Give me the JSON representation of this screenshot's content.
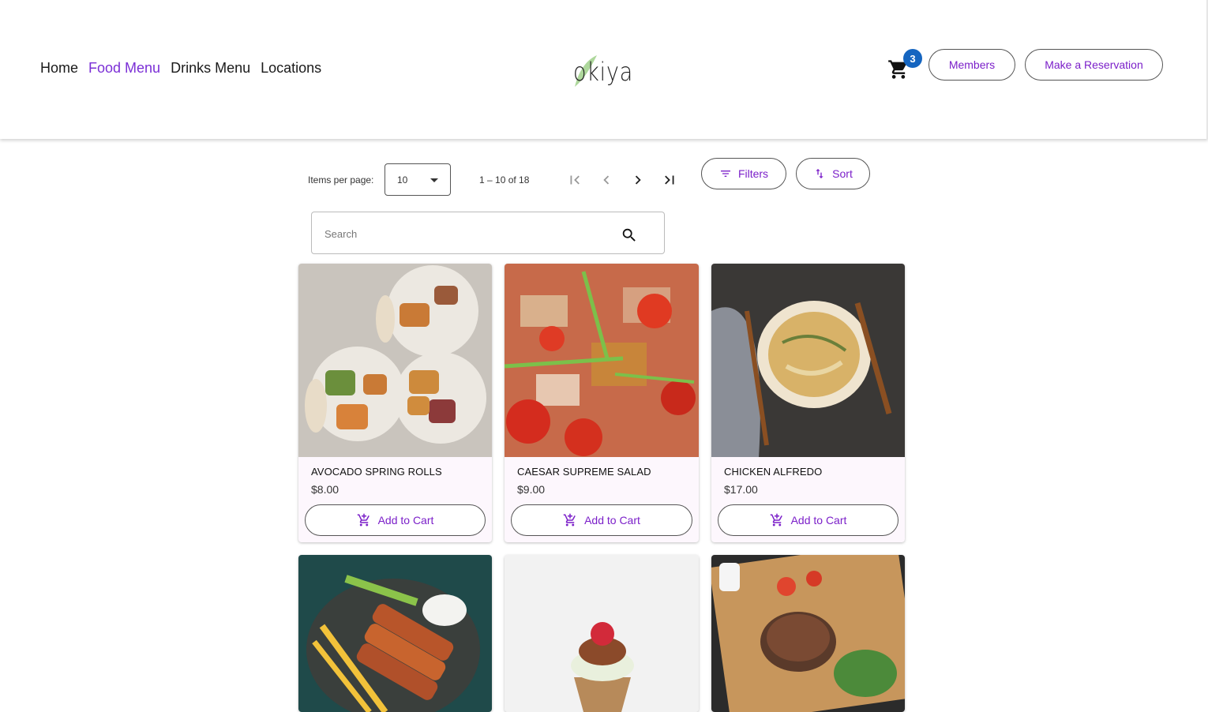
{
  "nav": {
    "items": [
      {
        "label": "Home",
        "active": false
      },
      {
        "label": "Food Menu",
        "active": true
      },
      {
        "label": "Drinks Menu",
        "active": false
      },
      {
        "label": "Locations",
        "active": false
      }
    ]
  },
  "logo": {
    "text": "okiya"
  },
  "cart": {
    "count": "3",
    "icon": "shopping-cart-icon"
  },
  "header_buttons": {
    "members": "Members",
    "reservation": "Make a Reservation"
  },
  "paginator": {
    "items_per_page_label": "Items per page:",
    "items_per_page_value": "10",
    "range_label": "1 – 10 of 18"
  },
  "toolbar": {
    "filters": "Filters",
    "sort": "Sort"
  },
  "search": {
    "placeholder": "Search"
  },
  "colors": {
    "accent": "#7b1fc9",
    "badge": "#1565c0",
    "card_bg": "#fdf7fd"
  },
  "products": [
    {
      "name": "AVOCADO SPRING ROLLS",
      "price": "$8.00",
      "add_label": "Add to Cart"
    },
    {
      "name": "CAESAR SUPREME SALAD",
      "price": "$9.00",
      "add_label": "Add to Cart"
    },
    {
      "name": "CHICKEN ALFREDO",
      "price": "$17.00",
      "add_label": "Add to Cart"
    },
    {
      "name": "",
      "price": "",
      "add_label": ""
    },
    {
      "name": "",
      "price": "",
      "add_label": ""
    },
    {
      "name": "",
      "price": "",
      "add_label": ""
    }
  ]
}
